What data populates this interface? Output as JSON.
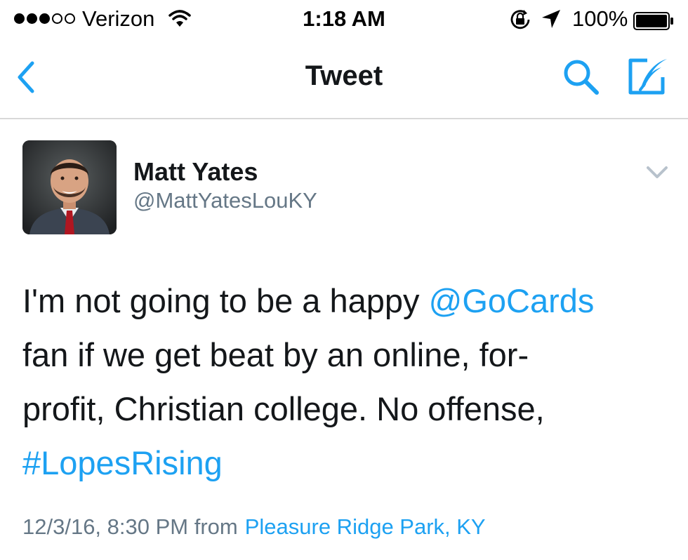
{
  "status_bar": {
    "carrier": "Verizon",
    "time": "1:18 AM",
    "battery_percent": "100%",
    "signal_bars_filled": 3,
    "signal_bars_total": 5
  },
  "nav": {
    "title": "Tweet",
    "icons": [
      "chevron-left-icon",
      "search-icon",
      "compose-icon"
    ]
  },
  "tweet": {
    "author": {
      "display_name": "Matt Yates",
      "handle": "@MattYatesLouKY"
    },
    "text_lines": {
      "l1_text": "I'm not going to be a happy ",
      "l1_mention": "@GoCards",
      "l2": "fan if we get beat by an online, for-",
      "l3": "profit, Christian college. No offense,",
      "l4_hashtag": "#LopesRising"
    },
    "timestamp": "12/3/16, 8:30 PM from",
    "location": "Pleasure Ridge Park, KY"
  },
  "colors": {
    "accent": "#1da1f2",
    "secondary_text": "#657786",
    "primary_text": "#14171a",
    "divider": "#d8d8d8"
  }
}
